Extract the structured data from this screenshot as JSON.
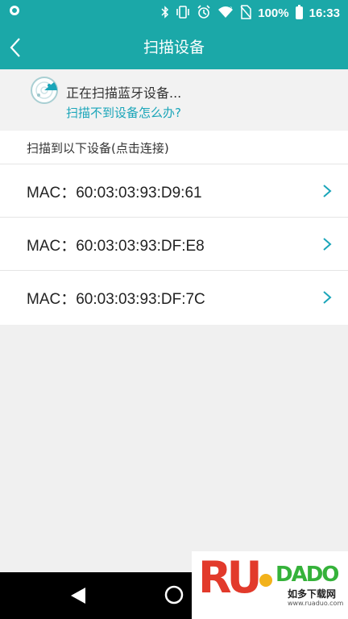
{
  "status_bar": {
    "battery": "100%",
    "time": "16:33",
    "icons": [
      "bluetooth-icon",
      "vibrate-icon",
      "alarm-icon",
      "wifi-icon",
      "no-sim-icon"
    ],
    "battery_level": 1.0
  },
  "app_bar": {
    "title": "扫描设备",
    "color": "#1ba8a8"
  },
  "scan": {
    "status": "正在扫描蓝牙设备...",
    "help_link": "扫描不到设备怎么办?"
  },
  "section": {
    "header": "扫描到以下设备(点击连接)"
  },
  "devices": [
    {
      "label": "MAC：60:03:03:93:D9:61"
    },
    {
      "label": "MAC：60:03:03:93:DF:E8"
    },
    {
      "label": "MAC：60:03:03:93:DF:7C"
    }
  ],
  "watermark": {
    "brand": "RUADADO",
    "brand_left": "RU",
    "brand_right": "DADO",
    "cn": "如多下载网",
    "url": "www.ruaduo.com"
  },
  "colors": {
    "accent": "#1ba8a8",
    "link": "#1aa5b9"
  }
}
